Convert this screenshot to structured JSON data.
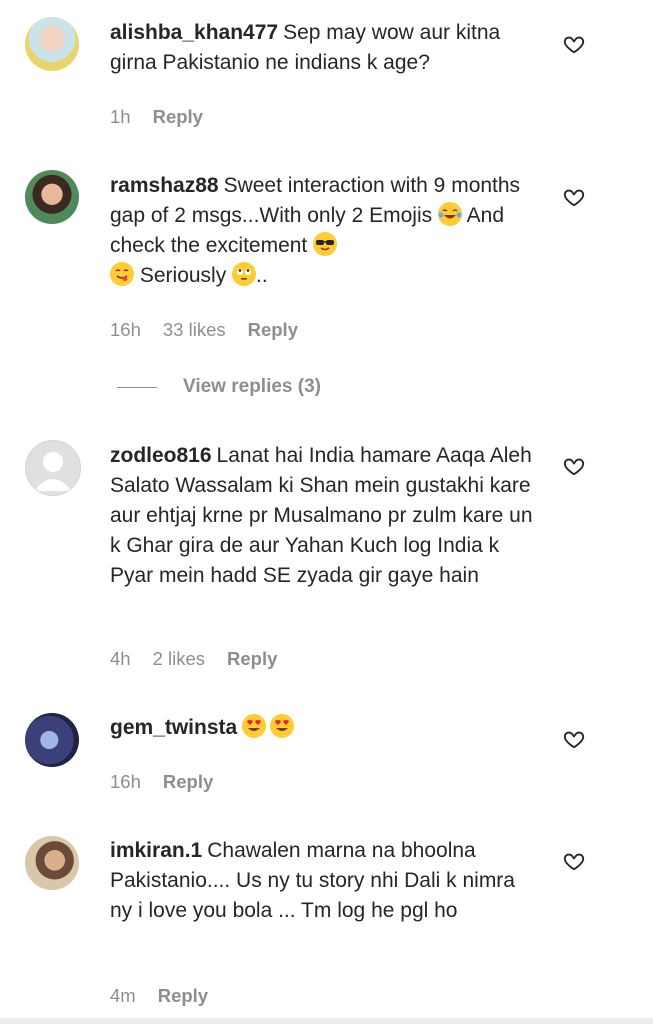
{
  "comments": [
    {
      "username": "alishba_khan477",
      "text": "Sep may wow aur kitna girna Pakistanio ne indians k age?",
      "time": "1h",
      "likes": "",
      "reply_label": "Reply"
    },
    {
      "username": "ramshaz88",
      "text_parts": [
        "Sweet interaction with 9 months gap of 2 msgs...With only 2 Emojis ",
        " And check the excitement ",
        " ",
        " Seriously ",
        ".."
      ],
      "emojis": [
        "face-with-tears-of-joy",
        "smiling-face-with-sunglasses",
        "face-savoring-food",
        "face-with-rolling-eyes"
      ],
      "time": "16h",
      "likes": "33 likes",
      "reply_label": "Reply",
      "view_replies": "View replies (3)"
    },
    {
      "username": "zodleo816",
      "text": "Lanat hai India hamare Aaqa Aleh Salato Wassalam ki Shan mein gustakhi kare aur ehtjaj krne pr Musalmano pr zulm kare un k Ghar gira de aur Yahan Kuch log India k Pyar mein hadd SE zyada gir gaye hain",
      "time": "4h",
      "likes": "2 likes",
      "reply_label": "Reply"
    },
    {
      "username": "gem_twinsta",
      "emojis": [
        "smiling-face-with-heart-eyes",
        "smiling-face-with-heart-eyes"
      ],
      "time": "16h",
      "likes": "",
      "reply_label": "Reply"
    },
    {
      "username": "imkiran.1",
      "text": "Chawalen marna na bhoolna Pakistanio.... Us ny tu story nhi Dali k nimra ny i love you bola ... Tm log he pgl ho",
      "time": "4m",
      "likes": "",
      "reply_label": "Reply"
    }
  ],
  "icons": {
    "like": "heart-outline-icon",
    "default_avatar": "default-avatar-icon"
  },
  "colors": {
    "text": "#262626",
    "meta": "#8e8e8e",
    "emoji_yellow": "#ffcc33"
  }
}
